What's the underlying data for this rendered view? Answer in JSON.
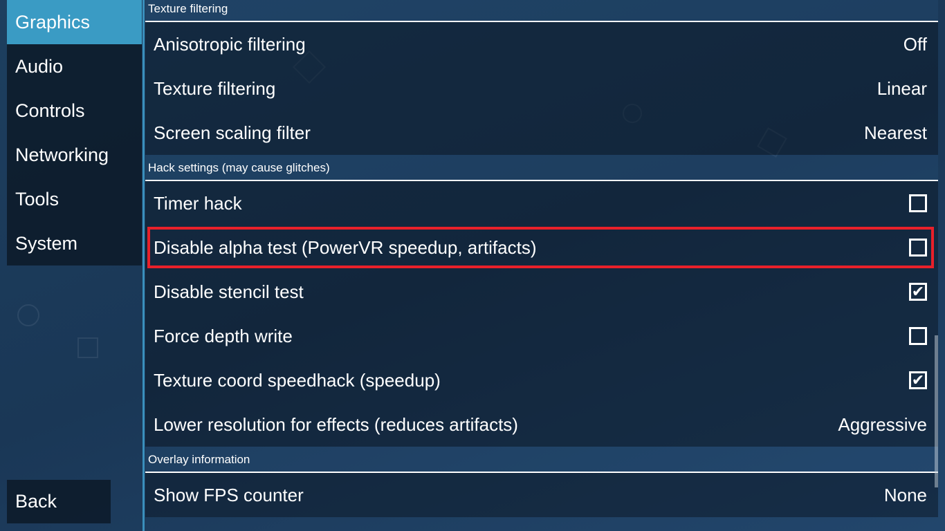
{
  "sidebar": {
    "tabs": [
      {
        "label": "Graphics",
        "selected": true
      },
      {
        "label": "Audio",
        "selected": false
      },
      {
        "label": "Controls",
        "selected": false
      },
      {
        "label": "Networking",
        "selected": false
      },
      {
        "label": "Tools",
        "selected": false
      },
      {
        "label": "System",
        "selected": false
      }
    ],
    "back_label": "Back"
  },
  "sections": {
    "texture": {
      "title": "Texture filtering",
      "rows": [
        {
          "label": "Anisotropic filtering",
          "value": "Off"
        },
        {
          "label": "Texture filtering",
          "value": "Linear"
        },
        {
          "label": "Screen scaling filter",
          "value": "Nearest"
        }
      ]
    },
    "hack": {
      "title": "Hack settings (may cause glitches)",
      "rows": [
        {
          "label": "Timer hack",
          "checked": false
        },
        {
          "label": "Disable alpha test (PowerVR speedup, artifacts)",
          "checked": false,
          "highlighted": true
        },
        {
          "label": "Disable stencil test",
          "checked": true
        },
        {
          "label": "Force depth write",
          "checked": false
        },
        {
          "label": "Texture coord speedhack (speedup)",
          "checked": true
        },
        {
          "label": "Lower resolution for effects (reduces artifacts)",
          "value": "Aggressive"
        }
      ]
    },
    "overlay": {
      "title": "Overlay information",
      "rows": [
        {
          "label": "Show FPS counter",
          "value": "None"
        }
      ]
    }
  },
  "colors": {
    "accent": "#3a9bc4",
    "highlight": "#e8202a"
  },
  "icons": {
    "checked": "checkmark-icon"
  }
}
